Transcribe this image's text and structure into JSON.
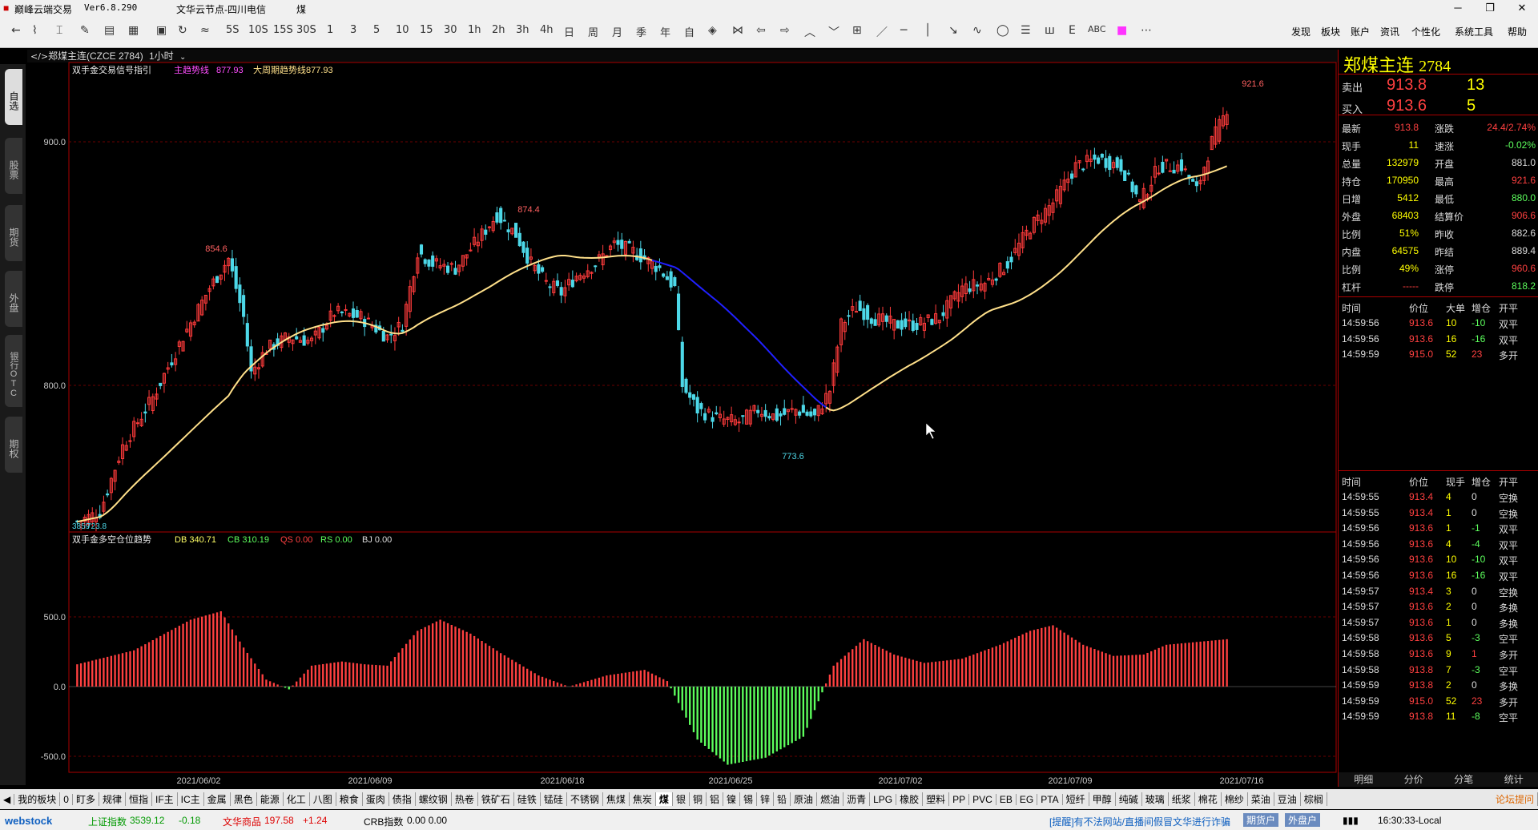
{
  "app": {
    "title": "巅峰云端交易",
    "version": "Ver6.8.290",
    "server": "文华云节点-四川电信",
    "menu_title": "煤"
  },
  "toolbar": {
    "periods": [
      "5S",
      "10S",
      "15S",
      "30S",
      "1",
      "3",
      "5",
      "10",
      "15",
      "30",
      "1h",
      "2h",
      "3h",
      "4h",
      "日",
      "周",
      "月",
      "季",
      "年",
      "自"
    ],
    "right_menu": [
      "发现",
      "板块",
      "账户",
      "资讯",
      "个性化",
      "系统工具",
      "帮助"
    ]
  },
  "left_tabs": [
    "自选",
    "股票",
    "期货",
    "外盘",
    "银行OTC",
    "期权"
  ],
  "chart_header": {
    "symbol_label": "郑煤主连(CZCE 2784)",
    "period": "1小时"
  },
  "main_indicator": {
    "name": "双手金交易信号指引",
    "l1_label": "主趋势线",
    "l1_value": "877.93",
    "l2_label": "大周期趋势线",
    "l2_value": "877.93"
  },
  "sub_indicator": {
    "name": "双手金多空仓位趋势",
    "db": "DB 340.71",
    "cb": "CB 310.19",
    "qs": "QS 0.00",
    "rs": "RS 0.00",
    "bj": "BJ 0.00"
  },
  "main_axis": {
    "ticks": [
      "900.0",
      "800.0"
    ]
  },
  "sub_axis": {
    "ticks": [
      "500.0",
      "0.0",
      "-500.0"
    ]
  },
  "x_axis": {
    "dates": [
      "2021/06/02",
      "2021/06/09",
      "2021/06/18",
      "2021/06/25",
      "2021/07/02",
      "2021/07/09",
      "2021/07/16"
    ]
  },
  "annotations": {
    "h1": "854.6",
    "h2": "874.4",
    "low": "773.6",
    "high": "921.6",
    "start": "3859",
    "start2": "723.8"
  },
  "colors": {
    "up": "#ff3b3b",
    "down": "#4dd8e8",
    "ma": "#ffe08a",
    "ma_down": "#2020ff",
    "green": "#5dff5d",
    "red": "#ff4040",
    "yellow": "#ffff00"
  },
  "panel": {
    "name": "郑煤主连",
    "code": "2784",
    "sell_label": "卖出",
    "sell_price": "913.8",
    "sell_vol": "13",
    "buy_label": "买入",
    "buy_price": "913.6",
    "buy_vol": "5",
    "stats": [
      [
        "最新",
        "913.8",
        "涨跌",
        "24.4/2.74%"
      ],
      [
        "现手",
        "11",
        "速涨",
        "-0.02%"
      ],
      [
        "总量",
        "132979",
        "开盘",
        "881.0"
      ],
      [
        "持仓",
        "170950",
        "最高",
        "921.6"
      ],
      [
        "日增",
        "5412",
        "最低",
        "880.0"
      ],
      [
        "外盘",
        "68403",
        "结算价",
        "906.6"
      ],
      [
        "比例",
        "51%",
        "昨收",
        "882.6"
      ],
      [
        "内盘",
        "64575",
        "昨结",
        "889.4"
      ],
      [
        "比例",
        "49%",
        "涨停",
        "960.6"
      ],
      [
        "杠杆",
        "-----",
        "跌停",
        "818.2"
      ]
    ],
    "t1_head": [
      "时间",
      "价位",
      "大单",
      "增仓",
      "开平"
    ],
    "t1": [
      [
        "14:59:56",
        "913.6",
        "10",
        "-10",
        "双平"
      ],
      [
        "14:59:56",
        "913.6",
        "16",
        "-16",
        "双平"
      ],
      [
        "14:59:59",
        "915.0",
        "52",
        "23",
        "多开"
      ]
    ],
    "t2_head": [
      "时间",
      "价位",
      "现手",
      "增仓",
      "开平"
    ],
    "t2": [
      [
        "14:59:55",
        "913.4",
        "4",
        "0",
        "空换"
      ],
      [
        "14:59:55",
        "913.4",
        "1",
        "0",
        "空换"
      ],
      [
        "14:59:56",
        "913.6",
        "1",
        "-1",
        "双平"
      ],
      [
        "14:59:56",
        "913.6",
        "4",
        "-4",
        "双平"
      ],
      [
        "14:59:56",
        "913.6",
        "10",
        "-10",
        "双平"
      ],
      [
        "14:59:56",
        "913.6",
        "16",
        "-16",
        "双平"
      ],
      [
        "14:59:57",
        "913.4",
        "3",
        "0",
        "空换"
      ],
      [
        "14:59:57",
        "913.6",
        "2",
        "0",
        "多换"
      ],
      [
        "14:59:57",
        "913.6",
        "1",
        "0",
        "多换"
      ],
      [
        "14:59:58",
        "913.6",
        "5",
        "-3",
        "空平"
      ],
      [
        "14:59:58",
        "913.6",
        "9",
        "1",
        "多开"
      ],
      [
        "14:59:58",
        "913.8",
        "7",
        "-3",
        "空平"
      ],
      [
        "14:59:59",
        "913.8",
        "2",
        "0",
        "多换"
      ],
      [
        "14:59:59",
        "915.0",
        "52",
        "23",
        "多开"
      ],
      [
        "14:59:59",
        "913.8",
        "11",
        "-8",
        "空平"
      ]
    ],
    "bottom_tabs": [
      "明细",
      "分价",
      "分笔",
      "统计"
    ]
  },
  "bottom_tabs": [
    "我的板块",
    "0",
    "盯多",
    "规律",
    "恒指",
    "IF主",
    "IC主",
    "金属",
    "黑色",
    "能源",
    "化工",
    "八图",
    "粮食",
    "蛋肉",
    "债指",
    "螺纹钢",
    "热卷",
    "铁矿石",
    "硅铁",
    "锰硅",
    "不锈钢",
    "焦煤",
    "焦炭",
    "煤",
    "银",
    "铜",
    "铝",
    "镍",
    "锡",
    "锌",
    "铅",
    "原油",
    "燃油",
    "沥青",
    "LPG",
    "橡胶",
    "塑料",
    "PP",
    "PVC",
    "EB",
    "EG",
    "PTA",
    "短纤",
    "甲醇",
    "纯碱",
    "玻璃",
    "纸浆",
    "棉花",
    "棉纱",
    "菜油",
    "豆油",
    "棕榈"
  ],
  "status": {
    "logo": "webstock",
    "sh": "上证指数",
    "sh_val": "3539.12",
    "sh_chg": "-0.18",
    "wh": "文华商品",
    "wh_val": "197.58",
    "wh_chg": "+1.24",
    "crb": "CRB指数",
    "crb_val": "0.00 0.00",
    "notice": "[提醒]有不法网站/直播间假冒文华进行诈骗",
    "b1": "期货户",
    "b2": "外盘户",
    "time": "16:30:33-Local",
    "forum": "论坛提问"
  }
}
